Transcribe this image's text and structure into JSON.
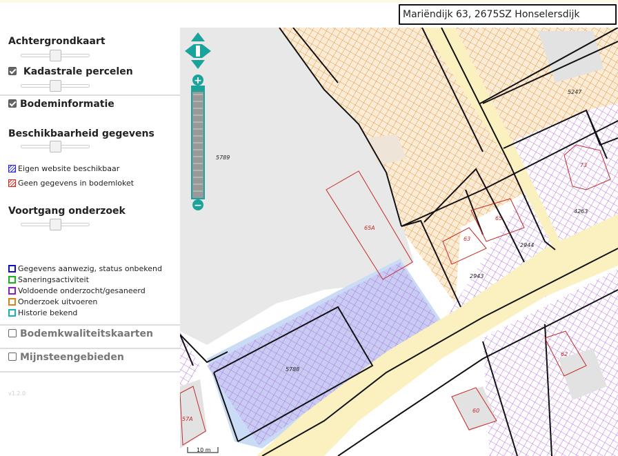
{
  "search": {
    "value": "Mariëndijk 63, 2675SZ Honselersdijk"
  },
  "sidebar": {
    "achtergrondkaart": {
      "label": "Achtergrondkaart"
    },
    "kadastrale": {
      "label": "Kadastrale percelen",
      "checked": true
    },
    "bodeminformatie": {
      "label": "Bodeminformatie",
      "checked": true
    },
    "beschikbaarheid": {
      "label": "Beschikbaarheid gegevens",
      "legend": [
        {
          "label": "Eigen website beschikbaar",
          "color": "#1a1aff"
        },
        {
          "label": "Geen gegevens in bodemloket",
          "color": "#e0201b"
        }
      ]
    },
    "voortgang": {
      "label": "Voortgang onderzoek",
      "legend": [
        {
          "label": "Gegevens aanwezig, status onbekend",
          "color": "#0d0dcc"
        },
        {
          "label": "Saneringsactiviteit",
          "color": "#17b317"
        },
        {
          "label": "Voldoende onderzocht/gesaneerd",
          "color": "#8a1fbf"
        },
        {
          "label": "Onderzoek uitvoeren",
          "color": "#d9801a"
        },
        {
          "label": "Historie bekend",
          "color": "#19b3b3"
        }
      ]
    },
    "bodemkwaliteitskaarten": {
      "label": "Bodemkwaliteitskaarten",
      "checked": false
    },
    "mijnsteengebieden": {
      "label": "Mijnsteengebieden",
      "checked": false
    },
    "version": "v1.2.0"
  },
  "map": {
    "zoom": {
      "plus": "+",
      "minus": "−"
    },
    "scale_label": "10 m",
    "parcels": [
      "5789",
      "5247",
      "73",
      "4263",
      "65A",
      "65",
      "63",
      "2944",
      "2943",
      "5788",
      "62",
      "60",
      "57A"
    ],
    "colors": {
      "road": "#fbf3c4",
      "parcel_line": "#111111",
      "building": "#c62828",
      "grey_area": "#e7e7e7",
      "orange_hatch": "#d9801a",
      "purple_hatch": "#9b30d9",
      "blue_fill": "#c5d9f4",
      "nav": "#1aa39a"
    }
  }
}
